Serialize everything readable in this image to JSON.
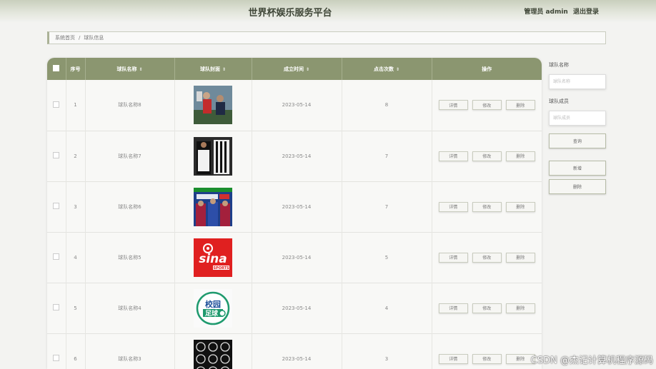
{
  "header": {
    "title": "世界杯娱乐服务平台",
    "user": "管理员 admin",
    "logout": "退出登录"
  },
  "breadcrumb": {
    "home": "系统首页",
    "separator": "/",
    "current": "球队信息"
  },
  "table": {
    "columns": {
      "index": "序号",
      "name": "球队名称",
      "cover": "球队封面",
      "date": "成立时间",
      "clicks": "点击次数",
      "actions": "操作"
    },
    "action_labels": {
      "detail": "详情",
      "edit": "修改",
      "delete": "删除"
    },
    "rows": [
      {
        "index": "1",
        "name": "球队名称8",
        "date": "2023-05-14",
        "clicks": "8",
        "cover": "team-photo-red"
      },
      {
        "index": "2",
        "name": "球队名称7",
        "date": "2023-05-14",
        "clicks": "7",
        "cover": "players-jerseys"
      },
      {
        "index": "3",
        "name": "球队名称6",
        "date": "2023-05-14",
        "clicks": "7",
        "cover": "pes-game-cover"
      },
      {
        "index": "4",
        "name": "球队名称5",
        "date": "2023-05-14",
        "clicks": "5",
        "cover": "sina-sports-logo"
      },
      {
        "index": "5",
        "name": "球队名称4",
        "date": "2023-05-14",
        "clicks": "4",
        "cover": "campus-football-logo"
      },
      {
        "index": "6",
        "name": "球队名称3",
        "date": "2023-05-14",
        "clicks": "3",
        "cover": "club-badges-grid"
      }
    ]
  },
  "sidebar": {
    "name_label": "球队名称",
    "name_placeholder": "球队名称",
    "member_label": "球队成员",
    "member_placeholder": "球队成员",
    "search_button": "查询",
    "add_button": "新增",
    "delete_button": "删除"
  },
  "cover_logos": {
    "sina_text": "sina",
    "sina_sub": "SPORTS",
    "campus_line1": "校园",
    "campus_line2": "足球"
  },
  "watermark": "CSDN @杰记计算机程序源码",
  "colors": {
    "header_bg": "#8b9670",
    "sina_red": "#e02020",
    "campus_green": "#1f9a6e"
  }
}
